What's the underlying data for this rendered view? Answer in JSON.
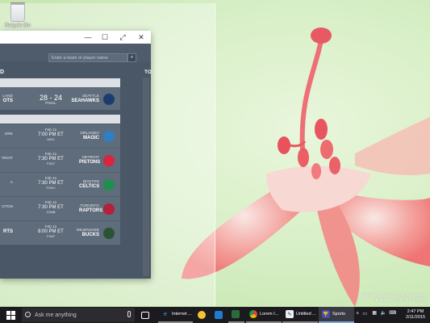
{
  "desktop": {
    "recycle_bin_label": "Recycle Bin"
  },
  "window": {
    "controls": {
      "minimize": "—",
      "maximize": "☐",
      "restore": "⤢",
      "close": "✕"
    }
  },
  "search": {
    "placeholder": "Enter a team or player name"
  },
  "sections": {
    "left_header": "D",
    "right_header": "TO"
  },
  "featured_game": {
    "left_city": "LAND",
    "left_team": "OTS",
    "score": "28 - 24",
    "status": "FINAL",
    "right_city": "SEATTLE",
    "right_team": "SEAHAWKS"
  },
  "games": [
    {
      "left_city": "ORK",
      "left_team": "",
      "date": "Feb 11",
      "time": "7:00 PM ET",
      "network": "MSG",
      "right_city": "ORLANDO",
      "right_team": "MAGIC"
    },
    {
      "left_city": "TROIT",
      "left_team": "",
      "date": "Feb 11",
      "time": "7:30 PM ET",
      "network": "FSDT",
      "right_city": "DETROIT",
      "right_team": "PISTONS"
    },
    {
      "left_city": "A",
      "left_team": "",
      "date": "Feb 11",
      "time": "7:30 PM ET",
      "network": "FSSO",
      "right_city": "BOSTON",
      "right_team": "CELTICS"
    },
    {
      "left_city": "GTON",
      "left_team": "",
      "date": "Feb 11",
      "time": "7:30 PM ET",
      "network": "CSNB",
      "right_city": "TORONTO",
      "right_team": "RAPTORS"
    },
    {
      "left_city": "",
      "left_team": "RTS",
      "date": "Feb 11",
      "time": "8:00 PM ET",
      "network": "FSAF",
      "right_city": "MILWAUKEE",
      "right_team": "BUCKS"
    }
  ],
  "watermark": {
    "line1": "Windows 10 Pro Technical Preview",
    "line2": "Evaluation copy. Build 9926"
  },
  "taskbar": {
    "search_placeholder": "Ask me anything",
    "items": [
      {
        "label": "",
        "icon": "task-view-icon"
      },
      {
        "label": "",
        "icon": "file-explorer-icon"
      },
      {
        "label": "Internet ...",
        "icon": "internet-explorer-icon"
      },
      {
        "label": "",
        "icon": "emoji-icon"
      },
      {
        "label": "",
        "icon": "store-icon"
      },
      {
        "label": "",
        "icon": "terminal-icon"
      },
      {
        "label": "Lorem I...",
        "icon": "chrome-icon"
      },
      {
        "label": "Untitled ...",
        "icon": "paint-icon"
      },
      {
        "label": "Sports",
        "icon": "sports-icon"
      }
    ],
    "clock_time": "2:47 PM",
    "clock_date": "2/11/2015"
  }
}
